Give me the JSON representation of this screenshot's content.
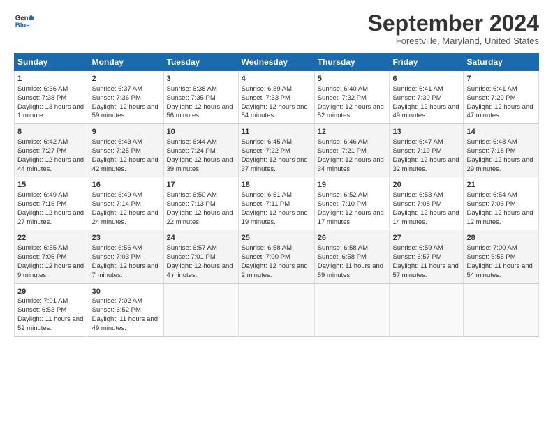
{
  "header": {
    "logo_line1": "General",
    "logo_line2": "Blue",
    "month_title": "September 2024",
    "location": "Forestville, Maryland, United States"
  },
  "columns": [
    "Sunday",
    "Monday",
    "Tuesday",
    "Wednesday",
    "Thursday",
    "Friday",
    "Saturday"
  ],
  "weeks": [
    [
      {
        "day": "1",
        "sunrise": "Sunrise: 6:36 AM",
        "sunset": "Sunset: 7:38 PM",
        "daylight": "Daylight: 13 hours and 1 minute."
      },
      {
        "day": "2",
        "sunrise": "Sunrise: 6:37 AM",
        "sunset": "Sunset: 7:36 PM",
        "daylight": "Daylight: 12 hours and 59 minutes."
      },
      {
        "day": "3",
        "sunrise": "Sunrise: 6:38 AM",
        "sunset": "Sunset: 7:35 PM",
        "daylight": "Daylight: 12 hours and 56 minutes."
      },
      {
        "day": "4",
        "sunrise": "Sunrise: 6:39 AM",
        "sunset": "Sunset: 7:33 PM",
        "daylight": "Daylight: 12 hours and 54 minutes."
      },
      {
        "day": "5",
        "sunrise": "Sunrise: 6:40 AM",
        "sunset": "Sunset: 7:32 PM",
        "daylight": "Daylight: 12 hours and 52 minutes."
      },
      {
        "day": "6",
        "sunrise": "Sunrise: 6:41 AM",
        "sunset": "Sunset: 7:30 PM",
        "daylight": "Daylight: 12 hours and 49 minutes."
      },
      {
        "day": "7",
        "sunrise": "Sunrise: 6:41 AM",
        "sunset": "Sunset: 7:29 PM",
        "daylight": "Daylight: 12 hours and 47 minutes."
      }
    ],
    [
      {
        "day": "8",
        "sunrise": "Sunrise: 6:42 AM",
        "sunset": "Sunset: 7:27 PM",
        "daylight": "Daylight: 12 hours and 44 minutes."
      },
      {
        "day": "9",
        "sunrise": "Sunrise: 6:43 AM",
        "sunset": "Sunset: 7:25 PM",
        "daylight": "Daylight: 12 hours and 42 minutes."
      },
      {
        "day": "10",
        "sunrise": "Sunrise: 6:44 AM",
        "sunset": "Sunset: 7:24 PM",
        "daylight": "Daylight: 12 hours and 39 minutes."
      },
      {
        "day": "11",
        "sunrise": "Sunrise: 6:45 AM",
        "sunset": "Sunset: 7:22 PM",
        "daylight": "Daylight: 12 hours and 37 minutes."
      },
      {
        "day": "12",
        "sunrise": "Sunrise: 6:46 AM",
        "sunset": "Sunset: 7:21 PM",
        "daylight": "Daylight: 12 hours and 34 minutes."
      },
      {
        "day": "13",
        "sunrise": "Sunrise: 6:47 AM",
        "sunset": "Sunset: 7:19 PM",
        "daylight": "Daylight: 12 hours and 32 minutes."
      },
      {
        "day": "14",
        "sunrise": "Sunrise: 6:48 AM",
        "sunset": "Sunset: 7:18 PM",
        "daylight": "Daylight: 12 hours and 29 minutes."
      }
    ],
    [
      {
        "day": "15",
        "sunrise": "Sunrise: 6:49 AM",
        "sunset": "Sunset: 7:16 PM",
        "daylight": "Daylight: 12 hours and 27 minutes."
      },
      {
        "day": "16",
        "sunrise": "Sunrise: 6:49 AM",
        "sunset": "Sunset: 7:14 PM",
        "daylight": "Daylight: 12 hours and 24 minutes."
      },
      {
        "day": "17",
        "sunrise": "Sunrise: 6:50 AM",
        "sunset": "Sunset: 7:13 PM",
        "daylight": "Daylight: 12 hours and 22 minutes."
      },
      {
        "day": "18",
        "sunrise": "Sunrise: 6:51 AM",
        "sunset": "Sunset: 7:11 PM",
        "daylight": "Daylight: 12 hours and 19 minutes."
      },
      {
        "day": "19",
        "sunrise": "Sunrise: 6:52 AM",
        "sunset": "Sunset: 7:10 PM",
        "daylight": "Daylight: 12 hours and 17 minutes."
      },
      {
        "day": "20",
        "sunrise": "Sunrise: 6:53 AM",
        "sunset": "Sunset: 7:08 PM",
        "daylight": "Daylight: 12 hours and 14 minutes."
      },
      {
        "day": "21",
        "sunrise": "Sunrise: 6:54 AM",
        "sunset": "Sunset: 7:06 PM",
        "daylight": "Daylight: 12 hours and 12 minutes."
      }
    ],
    [
      {
        "day": "22",
        "sunrise": "Sunrise: 6:55 AM",
        "sunset": "Sunset: 7:05 PM",
        "daylight": "Daylight: 12 hours and 9 minutes."
      },
      {
        "day": "23",
        "sunrise": "Sunrise: 6:56 AM",
        "sunset": "Sunset: 7:03 PM",
        "daylight": "Daylight: 12 hours and 7 minutes."
      },
      {
        "day": "24",
        "sunrise": "Sunrise: 6:57 AM",
        "sunset": "Sunset: 7:01 PM",
        "daylight": "Daylight: 12 hours and 4 minutes."
      },
      {
        "day": "25",
        "sunrise": "Sunrise: 6:58 AM",
        "sunset": "Sunset: 7:00 PM",
        "daylight": "Daylight: 12 hours and 2 minutes."
      },
      {
        "day": "26",
        "sunrise": "Sunrise: 6:58 AM",
        "sunset": "Sunset: 6:58 PM",
        "daylight": "Daylight: 11 hours and 59 minutes."
      },
      {
        "day": "27",
        "sunrise": "Sunrise: 6:59 AM",
        "sunset": "Sunset: 6:57 PM",
        "daylight": "Daylight: 11 hours and 57 minutes."
      },
      {
        "day": "28",
        "sunrise": "Sunrise: 7:00 AM",
        "sunset": "Sunset: 6:55 PM",
        "daylight": "Daylight: 11 hours and 54 minutes."
      }
    ],
    [
      {
        "day": "29",
        "sunrise": "Sunrise: 7:01 AM",
        "sunset": "Sunset: 6:53 PM",
        "daylight": "Daylight: 11 hours and 52 minutes."
      },
      {
        "day": "30",
        "sunrise": "Sunrise: 7:02 AM",
        "sunset": "Sunset: 6:52 PM",
        "daylight": "Daylight: 11 hours and 49 minutes."
      },
      null,
      null,
      null,
      null,
      null
    ]
  ]
}
